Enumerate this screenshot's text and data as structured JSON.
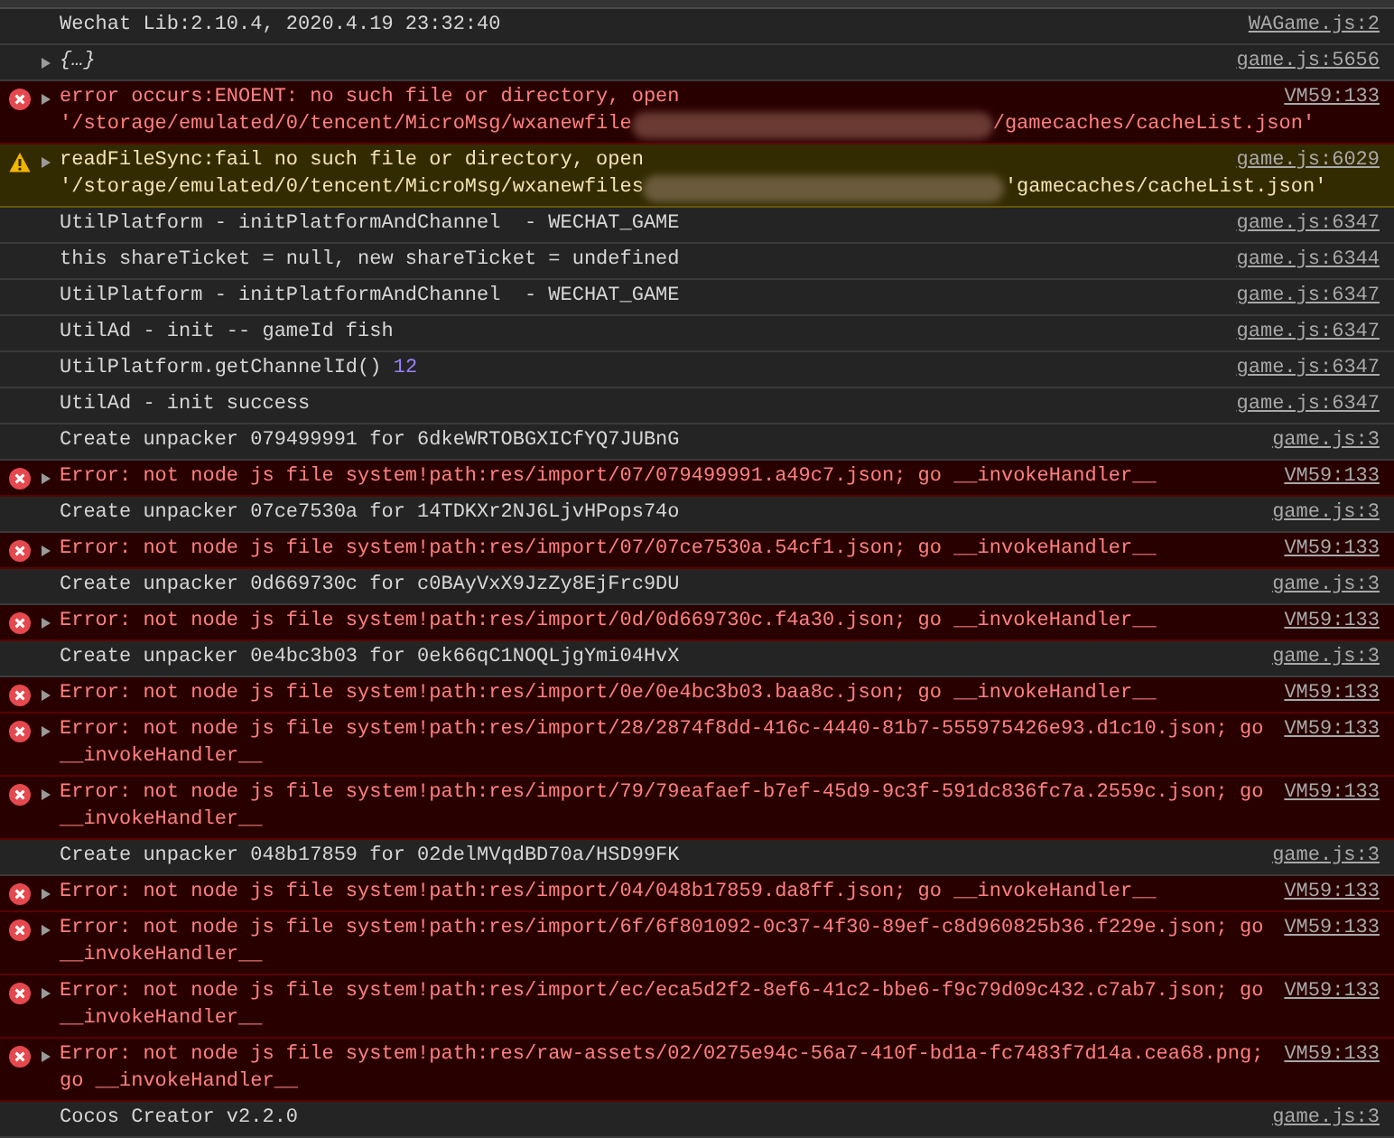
{
  "console": {
    "messages": [
      {
        "kind": "log",
        "expandable": false,
        "segments": [
          {
            "kind": "text",
            "text": "Wechat Lib:2.10.4, 2020.4.19 23:32:40"
          }
        ],
        "source": "WAGame.js:2"
      },
      {
        "kind": "log",
        "expandable": true,
        "segments": [
          {
            "kind": "object",
            "text": "{…}"
          }
        ],
        "source": "game.js:5656"
      },
      {
        "kind": "error",
        "expandable": true,
        "segments": [
          {
            "kind": "text",
            "text": "error occurs:ENOENT: no such file or directory, open"
          },
          {
            "kind": "text",
            "text": "'/storage/emulated/0/tencent/MicroMsg/wxanewfile"
          },
          {
            "kind": "redacted"
          },
          {
            "kind": "text",
            "text": "/gamecaches/cacheList.json'"
          }
        ],
        "source": "VM59:133"
      },
      {
        "kind": "warning",
        "expandable": true,
        "segments": [
          {
            "kind": "text",
            "text": "readFileSync:fail no such file or directory, open"
          },
          {
            "kind": "text",
            "text": "'/storage/emulated/0/tencent/MicroMsg/wxanewfiles"
          },
          {
            "kind": "redacted"
          },
          {
            "kind": "text",
            "text": "'gamecaches/cacheList.json'"
          }
        ],
        "source": "game.js:6029"
      },
      {
        "kind": "log",
        "expandable": false,
        "segments": [
          {
            "kind": "text",
            "text": "UtilPlatform - initPlatformAndChannel  - WECHAT_GAME"
          }
        ],
        "source": "game.js:6347"
      },
      {
        "kind": "log",
        "expandable": false,
        "segments": [
          {
            "kind": "text",
            "text": "this shareTicket = null, new shareTicket = undefined"
          }
        ],
        "source": "game.js:6344"
      },
      {
        "kind": "log",
        "expandable": false,
        "segments": [
          {
            "kind": "text",
            "text": "UtilPlatform - initPlatformAndChannel  - WECHAT_GAME"
          }
        ],
        "source": "game.js:6347"
      },
      {
        "kind": "log",
        "expandable": false,
        "segments": [
          {
            "kind": "text",
            "text": "UtilAd - init -- gameId fish"
          }
        ],
        "source": "game.js:6347"
      },
      {
        "kind": "log",
        "expandable": false,
        "segments": [
          {
            "kind": "text",
            "text": "UtilPlatform.getChannelId()"
          },
          {
            "kind": "number",
            "text": "12"
          }
        ],
        "source": "game.js:6347"
      },
      {
        "kind": "log",
        "expandable": false,
        "segments": [
          {
            "kind": "text",
            "text": "UtilAd - init success"
          }
        ],
        "source": "game.js:6347"
      },
      {
        "kind": "log",
        "expandable": false,
        "segments": [
          {
            "kind": "text",
            "text": "Create unpacker 079499991 for 6dkeWRTOBGXICfYQ7JUBnG"
          }
        ],
        "source": "game.js:3"
      },
      {
        "kind": "error",
        "expandable": true,
        "segments": [
          {
            "kind": "text",
            "text": "Error: not node js file system!path:res/import/07/079499991.a49c7.json; go __invokeHandler__"
          }
        ],
        "source": "VM59:133"
      },
      {
        "kind": "log",
        "expandable": false,
        "segments": [
          {
            "kind": "text",
            "text": "Create unpacker 07ce7530a for 14TDKXr2NJ6LjvHPops74o"
          }
        ],
        "source": "game.js:3"
      },
      {
        "kind": "error",
        "expandable": true,
        "segments": [
          {
            "kind": "text",
            "text": "Error: not node js file system!path:res/import/07/07ce7530a.54cf1.json; go __invokeHandler__"
          }
        ],
        "source": "VM59:133"
      },
      {
        "kind": "log",
        "expandable": false,
        "segments": [
          {
            "kind": "text",
            "text": "Create unpacker 0d669730c for c0BAyVxX9JzZy8EjFrc9DU"
          }
        ],
        "source": "game.js:3"
      },
      {
        "kind": "error",
        "expandable": true,
        "segments": [
          {
            "kind": "text",
            "text": "Error: not node js file system!path:res/import/0d/0d669730c.f4a30.json; go __invokeHandler__"
          }
        ],
        "source": "VM59:133"
      },
      {
        "kind": "log",
        "expandable": false,
        "segments": [
          {
            "kind": "text",
            "text": "Create unpacker 0e4bc3b03 for 0ek66qC1NOQLjgYmi04HvX"
          }
        ],
        "source": "game.js:3"
      },
      {
        "kind": "error",
        "expandable": true,
        "segments": [
          {
            "kind": "text",
            "text": "Error: not node js file system!path:res/import/0e/0e4bc3b03.baa8c.json; go __invokeHandler__"
          }
        ],
        "source": "VM59:133"
      },
      {
        "kind": "error",
        "expandable": true,
        "segments": [
          {
            "kind": "text",
            "text": "Error: not node js file system!path:res/import/28/2874f8dd-416c-4440-81b7-555975426e93.d1c10.json; go __invokeHandler__"
          }
        ],
        "source": "VM59:133"
      },
      {
        "kind": "error",
        "expandable": true,
        "segments": [
          {
            "kind": "text",
            "text": "Error: not node js file system!path:res/import/79/79eafaef-b7ef-45d9-9c3f-591dc836fc7a.2559c.json; go __invokeHandler__"
          }
        ],
        "source": "VM59:133"
      },
      {
        "kind": "log",
        "expandable": false,
        "segments": [
          {
            "kind": "text",
            "text": "Create unpacker 048b17859 for 02delMVqdBD70a/HSD99FK"
          }
        ],
        "source": "game.js:3"
      },
      {
        "kind": "error",
        "expandable": true,
        "segments": [
          {
            "kind": "text",
            "text": "Error: not node js file system!path:res/import/04/048b17859.da8ff.json; go __invokeHandler__"
          }
        ],
        "source": "VM59:133"
      },
      {
        "kind": "error",
        "expandable": true,
        "segments": [
          {
            "kind": "text",
            "text": "Error: not node js file system!path:res/import/6f/6f801092-0c37-4f30-89ef-c8d960825b36.f229e.json; go __invokeHandler__"
          }
        ],
        "source": "VM59:133"
      },
      {
        "kind": "error",
        "expandable": true,
        "segments": [
          {
            "kind": "text",
            "text": "Error: not node js file system!path:res/import/ec/eca5d2f2-8ef6-41c2-bbe6-f9c79d09c432.c7ab7.json; go __invokeHandler__"
          }
        ],
        "source": "VM59:133"
      },
      {
        "kind": "error",
        "expandable": true,
        "segments": [
          {
            "kind": "text",
            "text": "Error: not node js file system!path:res/raw-assets/02/0275e94c-56a7-410f-bd1a-fc7483f7d14a.cea68.png; go __invokeHandler__"
          }
        ],
        "source": "VM59:133"
      },
      {
        "kind": "log",
        "expandable": false,
        "segments": [
          {
            "kind": "text",
            "text": "Cocos Creator v2.2.0"
          }
        ],
        "source": "game.js:3"
      }
    ]
  }
}
